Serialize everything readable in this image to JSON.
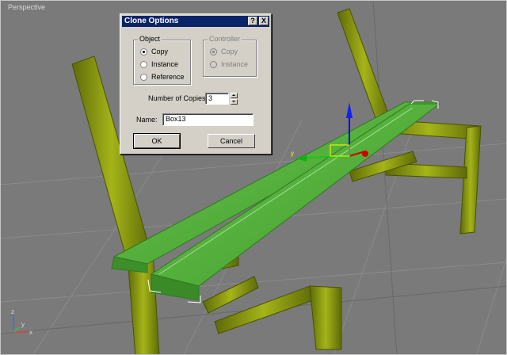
{
  "viewport": {
    "label": "Perspective"
  },
  "gizmo": {
    "axis_x": "x",
    "axis_y": "y",
    "axis_z": "z"
  },
  "scene_gizmo": {
    "label_y": "y"
  },
  "dialog": {
    "title": "Clone Options",
    "help_btn": "?",
    "close_btn": "X",
    "object_group": {
      "label": "Object",
      "options": [
        "Copy",
        "Instance",
        "Reference"
      ],
      "selected": "Copy"
    },
    "controller_group": {
      "label": "Controller",
      "options": [
        "Copy",
        "Instance"
      ],
      "selected": "Copy",
      "enabled": false
    },
    "copies_label": "Number of Copies:",
    "copies_value": "3",
    "name_label": "Name:",
    "name_value": "Box13",
    "ok_label": "OK",
    "cancel_label": "Cancel"
  },
  "colors": {
    "viewport_bg": "#7a7a7a",
    "bench_green": "#4aa835",
    "frame_olive": "#8a9a10",
    "title_blue": "#0a246a"
  }
}
